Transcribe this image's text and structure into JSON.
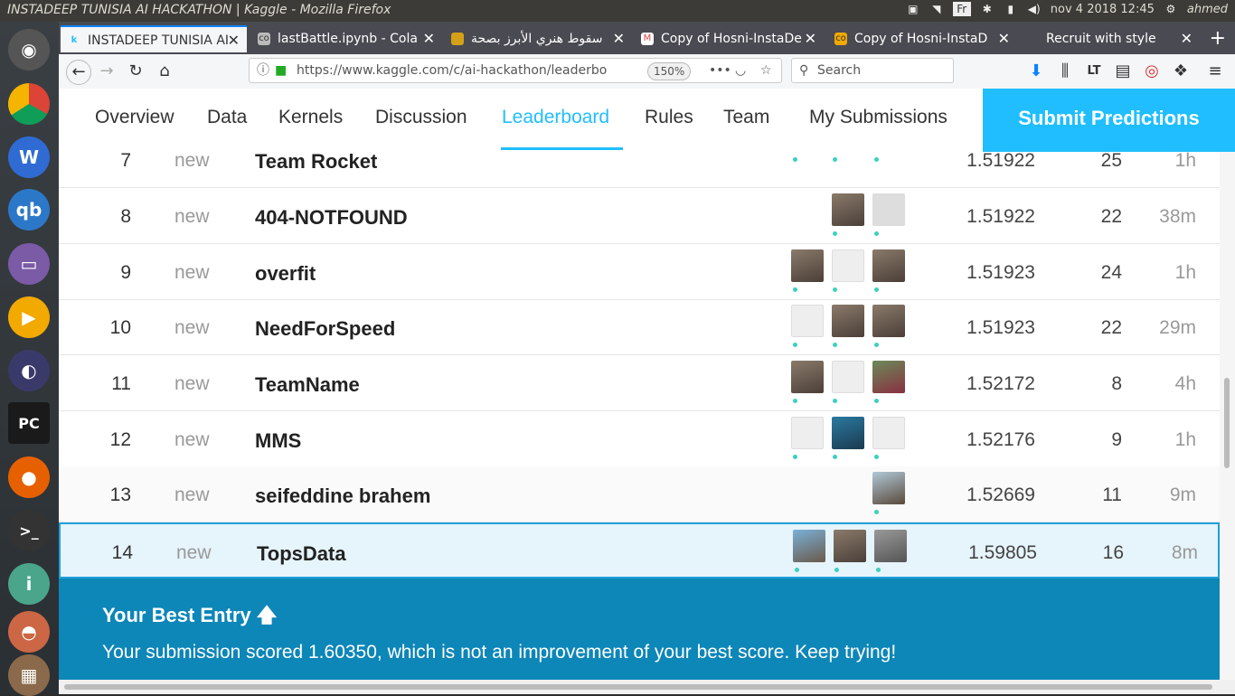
{
  "os": {
    "window_title": "INSTADEEP TUNISIA AI HACKATHON | Kaggle - Mozilla Firefox",
    "clock": "nov 4 2018 12:45",
    "user": "ahmed",
    "kbd": "Fr"
  },
  "browser": {
    "tabs": [
      {
        "label": "INSTADEEP TUNISIA AI",
        "icon": "kaggle-icon"
      },
      {
        "label": "lastBattle.ipynb - Cola",
        "icon": "colab-icon"
      },
      {
        "label": "سقوط هنري الأبرز بصحة",
        "icon": "site-icon"
      },
      {
        "label": "Copy of Hosni-InstaDe",
        "icon": "gmail-icon"
      },
      {
        "label": "Copy of Hosni-InstaD",
        "icon": "colab-icon"
      },
      {
        "label": "Recruit with style",
        "icon": "site-icon"
      }
    ],
    "url": "https://www.kaggle.com/c/ai-hackathon/leaderbo",
    "zoom": "150%",
    "search_placeholder": "Search"
  },
  "kaggle": {
    "nav": [
      "Overview",
      "Data",
      "Kernels",
      "Discussion",
      "Leaderboard",
      "Rules",
      "Team",
      "My Submissions"
    ],
    "submit_label": "Submit Predictions"
  },
  "leaderboard": {
    "rows": [
      {
        "rank": "7",
        "delta": "new",
        "team": "Team Rocket",
        "score": "1.51922",
        "entries": "25",
        "last": "1h"
      },
      {
        "rank": "8",
        "delta": "new",
        "team": "404-NOTFOUND",
        "score": "1.51922",
        "entries": "22",
        "last": "38m"
      },
      {
        "rank": "9",
        "delta": "new",
        "team": "overfit",
        "score": "1.51923",
        "entries": "24",
        "last": "1h"
      },
      {
        "rank": "10",
        "delta": "new",
        "team": "NeedForSpeed",
        "score": "1.51923",
        "entries": "22",
        "last": "29m"
      },
      {
        "rank": "11",
        "delta": "new",
        "team": "TeamName",
        "score": "1.52172",
        "entries": "8",
        "last": "4h"
      },
      {
        "rank": "12",
        "delta": "new",
        "team": "MMS",
        "score": "1.52176",
        "entries": "9",
        "last": "1h"
      },
      {
        "rank": "13",
        "delta": "new",
        "team": "seifeddine brahem",
        "score": "1.52669",
        "entries": "11",
        "last": "9m"
      },
      {
        "rank": "14",
        "delta": "new",
        "team": "TopsData",
        "score": "1.59805",
        "entries": "16",
        "last": "8m"
      }
    ]
  },
  "best_entry": {
    "heading": "Your Best Entry",
    "message": "Your submission scored 1.60350, which is not an improvement of your best score. Keep trying!"
  },
  "colors": {
    "accent": "#20beff",
    "banner": "#0d86b8",
    "highlight_row": "#e6f4fb"
  }
}
